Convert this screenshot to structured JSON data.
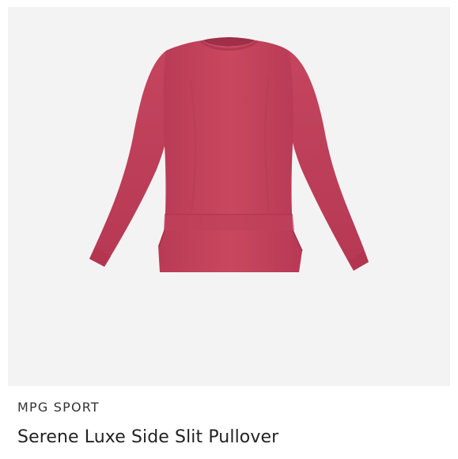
{
  "product": {
    "brand": "MPG SPORT",
    "name": "Serene Luxe Side Slit Pullover",
    "image": {
      "icon": "pullover-sweater-icon",
      "garment_color": "#c7445f",
      "background_color": "#f3f3f3"
    }
  }
}
